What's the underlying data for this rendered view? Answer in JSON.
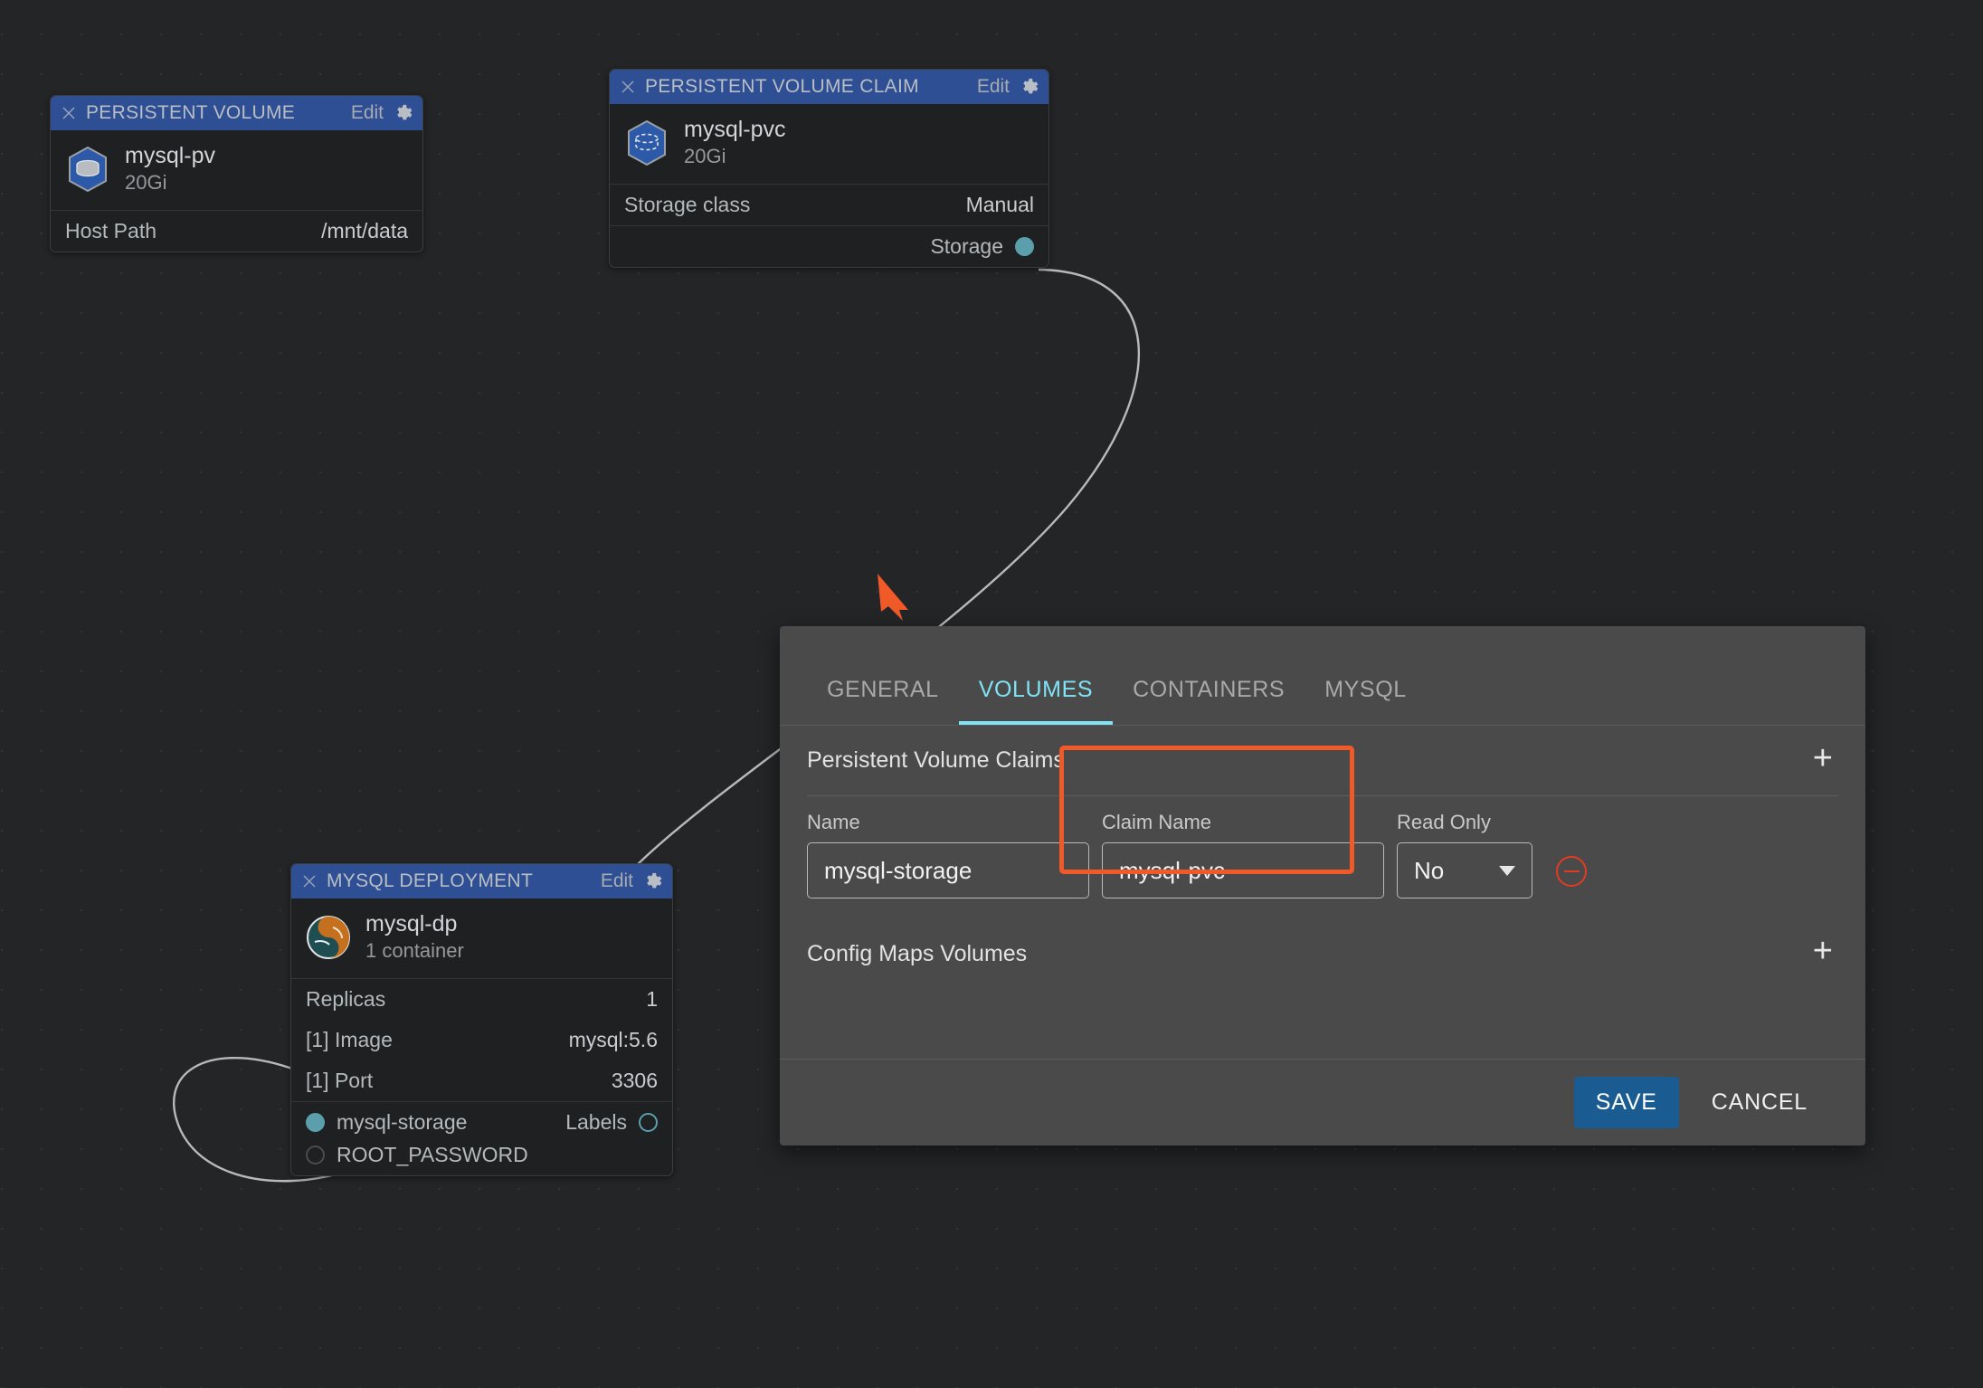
{
  "canvas": {
    "background_color": "#242526",
    "grid": "dot-grid"
  },
  "annotation": {
    "arrow_color": "#f05a28",
    "highlight_color": "#f05a28"
  },
  "cards": {
    "persistent_volume": {
      "header_title": "PERSISTENT VOLUME",
      "edit_label": "Edit",
      "close_icon": "close-icon",
      "gear_icon": "gear-icon",
      "icon": "k8s-persistent-volume-icon",
      "name": "mysql-pv",
      "capacity": "20Gi",
      "rows": [
        {
          "key": "Host Path",
          "value": "/mnt/data"
        }
      ]
    },
    "persistent_volume_claim": {
      "header_title": "PERSISTENT VOLUME CLAIM",
      "edit_label": "Edit",
      "close_icon": "close-icon",
      "gear_icon": "gear-icon",
      "icon": "k8s-persistent-volume-claim-icon",
      "name": "mysql-pvc",
      "capacity": "20Gi",
      "rows": [
        {
          "key": "Storage class",
          "value": "Manual"
        }
      ],
      "port_label": "Storage",
      "port_state": "connected"
    },
    "mysql_deployment": {
      "header_title": "MYSQL DEPLOYMENT",
      "edit_label": "Edit",
      "close_icon": "close-icon",
      "gear_icon": "gear-icon",
      "icon": "mysql-dolphin-icon",
      "name": "mysql-dp",
      "subtitle": "1 container",
      "rows": [
        {
          "key": "Replicas",
          "value": "1"
        },
        {
          "key": "[1] Image",
          "value": "mysql:5.6"
        },
        {
          "key": "[1] Port",
          "value": "3306"
        }
      ],
      "ports": [
        {
          "left_label": "mysql-storage",
          "left_state": "filled",
          "right_label": "Labels",
          "right_state": "hollow"
        },
        {
          "left_label": "ROOT_PASSWORD",
          "left_state": "hollow-dark",
          "right_label": "",
          "right_state": "none"
        }
      ]
    }
  },
  "panel": {
    "tabs": [
      {
        "label": "GENERAL",
        "active": false
      },
      {
        "label": "VOLUMES",
        "active": true
      },
      {
        "label": "CONTAINERS",
        "active": false
      },
      {
        "label": "MYSQL",
        "active": false
      }
    ],
    "active_tab_color": "#7fe3f5",
    "sections": [
      {
        "title": "Persistent Volume Claims",
        "add_label": "+"
      },
      {
        "title": "Config Maps Volumes",
        "add_label": "+"
      }
    ],
    "pvc_form": {
      "name_label": "Name",
      "claim_label": "Claim Name",
      "readonly_label": "Read Only",
      "name_value": "mysql-storage",
      "claim_value": "mysql-pvc",
      "readonly_value": "No",
      "remove_icon": "remove-circle-icon"
    },
    "footer": {
      "save_label": "SAVE",
      "cancel_label": "CANCEL",
      "save_color": "#1a5c92"
    }
  }
}
